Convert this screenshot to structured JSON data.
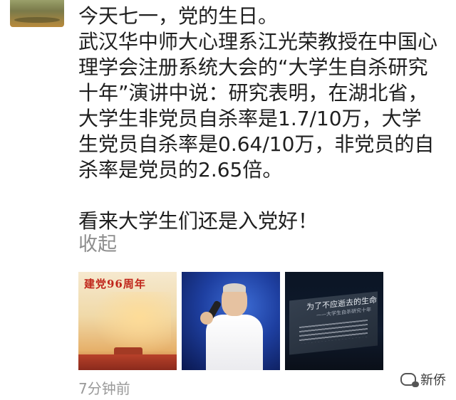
{
  "post": {
    "paragraphs": [
      "今天七一，党的生日。",
      "武汉华中师大心理系江光荣教授在中国心理学会注册系统大会的“大学生自杀研究十年”演讲中说：研究表明，在湖北省，大学生非党员自杀率是1.7/10万，大学生党员自杀率是0.64/10万，非党员的自杀率是党员的2.65倍。",
      "看来大学生们还是入党好！"
    ],
    "collapse_label": "收起",
    "timestamp": "7分钟前",
    "photos": {
      "photo1_title": "建党96周年",
      "photo3_title": "为了不应逝去的生命",
      "photo3_subtitle": "——大学生自杀研究十年"
    }
  },
  "watermark": {
    "text": "新侨",
    "icon": "chat-bubble-icon"
  }
}
